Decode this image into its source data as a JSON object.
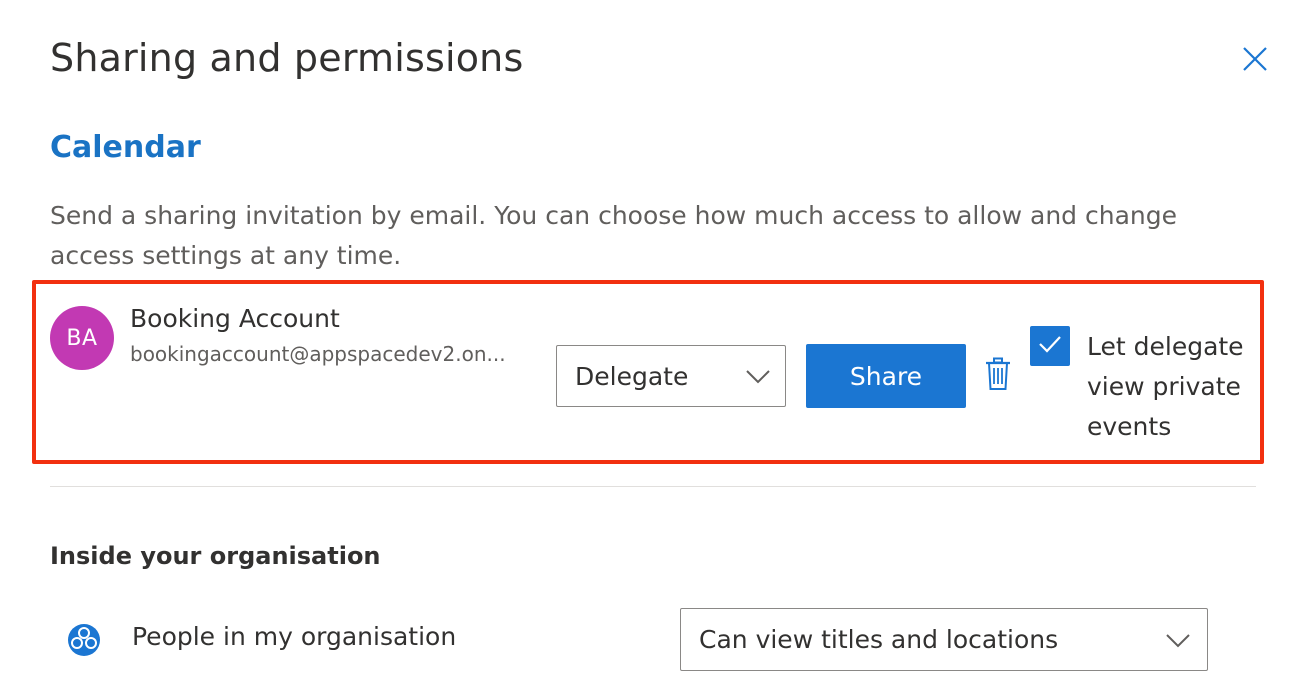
{
  "dialog": {
    "title": "Sharing and permissions",
    "close_icon": "close-icon"
  },
  "calendar": {
    "section_title": "Calendar",
    "description": "Send a sharing invitation by email. You can choose how much access to allow and change access settings at any time."
  },
  "invite": {
    "avatar_initials": "BA",
    "avatar_color": "#c239b3",
    "name": "Booking Account",
    "email": "bookingaccount@appspacedev2.on...",
    "role_selected": "Delegate",
    "share_label": "Share",
    "delete_icon": "trash-icon",
    "checkbox_checked": true,
    "checkbox_label": "Let delegate view private events",
    "highlight_color": "#f2300f"
  },
  "organisation": {
    "heading": "Inside your organisation",
    "people_label": "People in my organisation",
    "people_icon": "people-group-icon",
    "permission_selected": "Can view titles and locations"
  },
  "colors": {
    "accent": "#1b76d2",
    "link_blue": "#1a73c4"
  }
}
